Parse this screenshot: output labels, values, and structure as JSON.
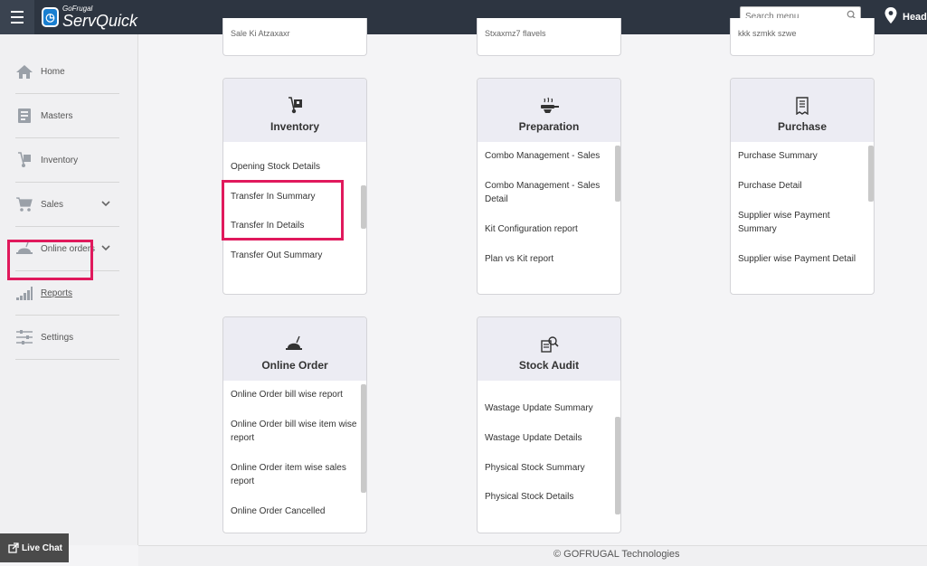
{
  "app": {
    "brand_small": "GoFrugal",
    "brand_big": "ServQuick"
  },
  "search": {
    "placeholder": "Search menu"
  },
  "header": {
    "location_label": "Head"
  },
  "sidebar": {
    "items": [
      {
        "label": "Home"
      },
      {
        "label": "Masters"
      },
      {
        "label": "Inventory"
      },
      {
        "label": "Sales"
      },
      {
        "label": "Online orders"
      },
      {
        "label": "Reports"
      },
      {
        "label": "Settings"
      }
    ]
  },
  "cut_cards": [
    {
      "text": "Sale Ki Atzaxaxr"
    },
    {
      "text": "Stxaxmz7 flavels"
    },
    {
      "text": "kkk szmkk szwe"
    }
  ],
  "cards": {
    "inventory": {
      "title": "Inventory",
      "items": [
        "Opening Stock Details",
        "Transfer In Summary",
        "Transfer In Details",
        "Transfer Out Summary"
      ]
    },
    "preparation": {
      "title": "Preparation",
      "items": [
        "Combo Management - Sales",
        "Combo Management - Sales Detail",
        "Kit Configuration report",
        "Plan vs Kit report"
      ]
    },
    "purchase": {
      "title": "Purchase",
      "items": [
        "Purchase Summary",
        "Purchase Detail",
        "Supplier wise Payment Summary",
        "Supplier wise Payment Detail"
      ]
    },
    "online_order": {
      "title": "Online Order",
      "items": [
        "Online Order bill wise report",
        "Online Order bill wise item wise report",
        "Online Order item wise sales report",
        "Online Order Cancelled"
      ]
    },
    "stock_audit": {
      "title": "Stock Audit",
      "items": [
        "Wastage Update Summary",
        "Wastage Update Details",
        "Physical Stock Summary",
        "Physical Stock Details"
      ]
    }
  },
  "footer": {
    "text": "© GOFRUGAL Technologies"
  },
  "livechat": {
    "label": "Live Chat"
  },
  "colors": {
    "topbar": "#2d3541",
    "highlight": "#e0195c",
    "card_head": "#ececf3"
  }
}
